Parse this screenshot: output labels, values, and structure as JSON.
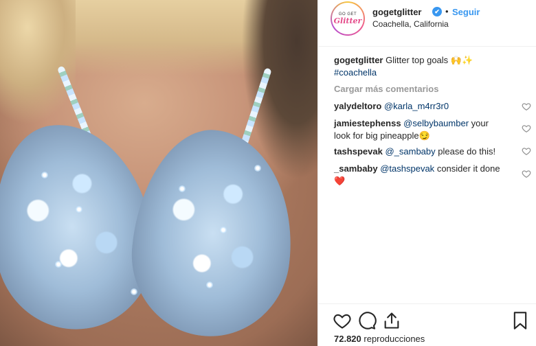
{
  "header": {
    "username": "gogetglitter",
    "follow_label": "Seguir",
    "location": "Coachella, California",
    "avatar_text_top": "GO GET",
    "avatar_text_bottom": "Glitter",
    "verified_glyph": "✔",
    "separator": "•"
  },
  "caption": {
    "username": "gogetglitter",
    "text": "Glitter top goals",
    "emojis": "🙌✨",
    "hashtag": "#coachella"
  },
  "load_more_label": "Cargar más comentarios",
  "comments": [
    {
      "username": "yalydeltoro",
      "mention": "@karla_m4rr3r0",
      "text": ""
    },
    {
      "username": "jamiestephenss",
      "mention": "@selbybaumber",
      "text": "your look for big pineapple😏"
    },
    {
      "username": "tashspevak",
      "mention": "@_sambaby",
      "text": "please do this!"
    },
    {
      "username": "_sambaby",
      "mention": "@tashspevak",
      "text": "consider it done ❤️"
    }
  ],
  "actions": {
    "like_icon": "heart-icon",
    "comment_icon": "comment-icon",
    "share_icon": "share-icon",
    "save_icon": "bookmark-icon"
  },
  "views": {
    "count": "72.820",
    "label": "reproducciones"
  },
  "colors": {
    "link_blue": "#3897f0",
    "mention_blue": "#003569",
    "text": "#262626",
    "muted": "#999999",
    "divider": "#efefef"
  }
}
